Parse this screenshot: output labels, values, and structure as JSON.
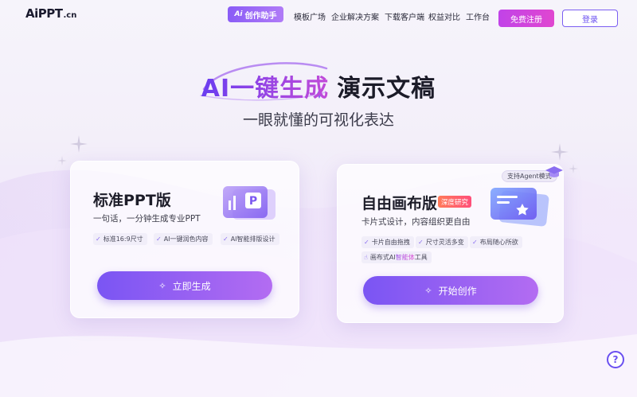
{
  "header": {
    "logo_main": "AiPPT",
    "logo_suffix": ".cn",
    "assistant_label": "创作助手",
    "assistant_mark": "Ai",
    "nav": [
      "模板广场",
      "企业解决方案",
      "下载客户端",
      "权益对比",
      "工作台"
    ],
    "signup_label": "免费注册",
    "login_label": "登录"
  },
  "hero": {
    "title_gradient": "AI一键生成",
    "title_plain": "演示文稿",
    "subtitle": "一眼就懂的可视化表达"
  },
  "cards": [
    {
      "title": "标准PPT版",
      "description": "一句话，一分钟生成专业PPT",
      "tags": [
        "标准16:9尺寸",
        "AI一键润色内容",
        "AI智能排版设计"
      ],
      "cta_label": "立即生成",
      "icon": "ppt-slide-icon"
    },
    {
      "title": "自由画布版",
      "badge": "深度研究",
      "corner_badge": "支持Agent模式",
      "description": "卡片式设计，内容组织更自由",
      "tags": [
        "卡片自由拖拽",
        "尺寸灵活多变",
        "布局随心所欲"
      ],
      "tag4_prefix": "画布式AI",
      "tag4_highlight": "智能体",
      "tag4_suffix": "工具",
      "cta_label": "开始创作",
      "icon": "canvas-card-icon"
    }
  ],
  "help_label": "?",
  "colors": {
    "accent": "#7a55f3",
    "accent_pink": "#e046d0",
    "badge_orange": "#ff5f6d"
  }
}
